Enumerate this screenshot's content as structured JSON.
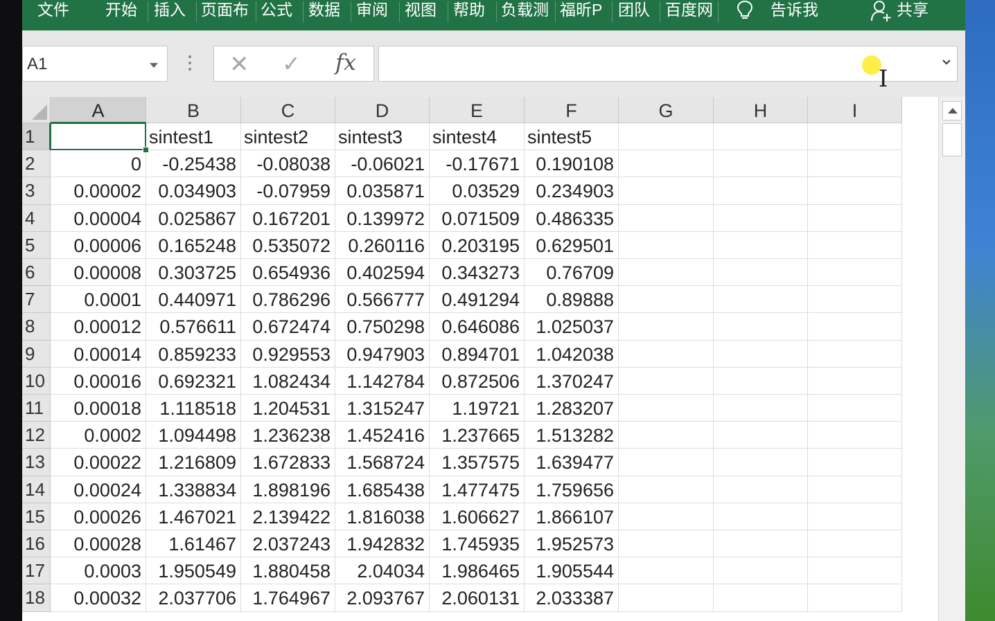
{
  "ribbon": {
    "tabs": [
      "文件",
      "开始",
      "插入",
      "页面布",
      "公式",
      "数据",
      "审阅",
      "视图",
      "帮助",
      "负载测",
      "福昕P",
      "团队",
      "百度网"
    ],
    "tell_me": "告诉我",
    "share": "共享"
  },
  "formula_bar": {
    "name_box": "A1",
    "cancel_glyph": "✕",
    "enter_glyph": "✓",
    "fx_glyph": "fx",
    "formula": ""
  },
  "sheet": {
    "columns": [
      "A",
      "B",
      "C",
      "D",
      "E",
      "F",
      "G",
      "H",
      "I"
    ],
    "rows": [
      {
        "n": "1",
        "cells": [
          "",
          "sintest1",
          "sintest2",
          "sintest3",
          "sintest4",
          "sintest5"
        ]
      },
      {
        "n": "2",
        "cells": [
          "0",
          "-0.25438",
          "-0.08038",
          "-0.06021",
          "-0.17671",
          "0.190108"
        ]
      },
      {
        "n": "3",
        "cells": [
          "0.00002",
          "0.034903",
          "-0.07959",
          "0.035871",
          "0.03529",
          "0.234903"
        ]
      },
      {
        "n": "4",
        "cells": [
          "0.00004",
          "0.025867",
          "0.167201",
          "0.139972",
          "0.071509",
          "0.486335"
        ]
      },
      {
        "n": "5",
        "cells": [
          "0.00006",
          "0.165248",
          "0.535072",
          "0.260116",
          "0.203195",
          "0.629501"
        ]
      },
      {
        "n": "6",
        "cells": [
          "0.00008",
          "0.303725",
          "0.654936",
          "0.402594",
          "0.343273",
          "0.76709"
        ]
      },
      {
        "n": "7",
        "cells": [
          "0.0001",
          "0.440971",
          "0.786296",
          "0.566777",
          "0.491294",
          "0.89888"
        ]
      },
      {
        "n": "8",
        "cells": [
          "0.00012",
          "0.576611",
          "0.672474",
          "0.750298",
          "0.646086",
          "1.025037"
        ]
      },
      {
        "n": "9",
        "cells": [
          "0.00014",
          "0.859233",
          "0.929553",
          "0.947903",
          "0.894701",
          "1.042038"
        ]
      },
      {
        "n": "10",
        "cells": [
          "0.00016",
          "0.692321",
          "1.082434",
          "1.142784",
          "0.872506",
          "1.370247"
        ]
      },
      {
        "n": "11",
        "cells": [
          "0.00018",
          "1.118518",
          "1.204531",
          "1.315247",
          "1.19721",
          "1.283207"
        ]
      },
      {
        "n": "12",
        "cells": [
          "0.0002",
          "1.094498",
          "1.236238",
          "1.452416",
          "1.237665",
          "1.513282"
        ]
      },
      {
        "n": "13",
        "cells": [
          "0.00022",
          "1.216809",
          "1.672833",
          "1.568724",
          "1.357575",
          "1.639477"
        ]
      },
      {
        "n": "14",
        "cells": [
          "0.00024",
          "1.338834",
          "1.898196",
          "1.685438",
          "1.477475",
          "1.759656"
        ]
      },
      {
        "n": "15",
        "cells": [
          "0.00026",
          "1.467021",
          "2.139422",
          "1.816038",
          "1.606627",
          "1.866107"
        ]
      },
      {
        "n": "16",
        "cells": [
          "0.00028",
          "1.61467",
          "2.037243",
          "1.942832",
          "1.745935",
          "1.952573"
        ]
      },
      {
        "n": "17",
        "cells": [
          "0.0003",
          "1.950549",
          "1.880458",
          "2.04034",
          "1.986465",
          "1.905544"
        ]
      },
      {
        "n": "18",
        "cells": [
          "0.00032",
          "2.037706",
          "1.764967",
          "2.093767",
          "2.060131",
          "2.033387"
        ]
      }
    ]
  }
}
